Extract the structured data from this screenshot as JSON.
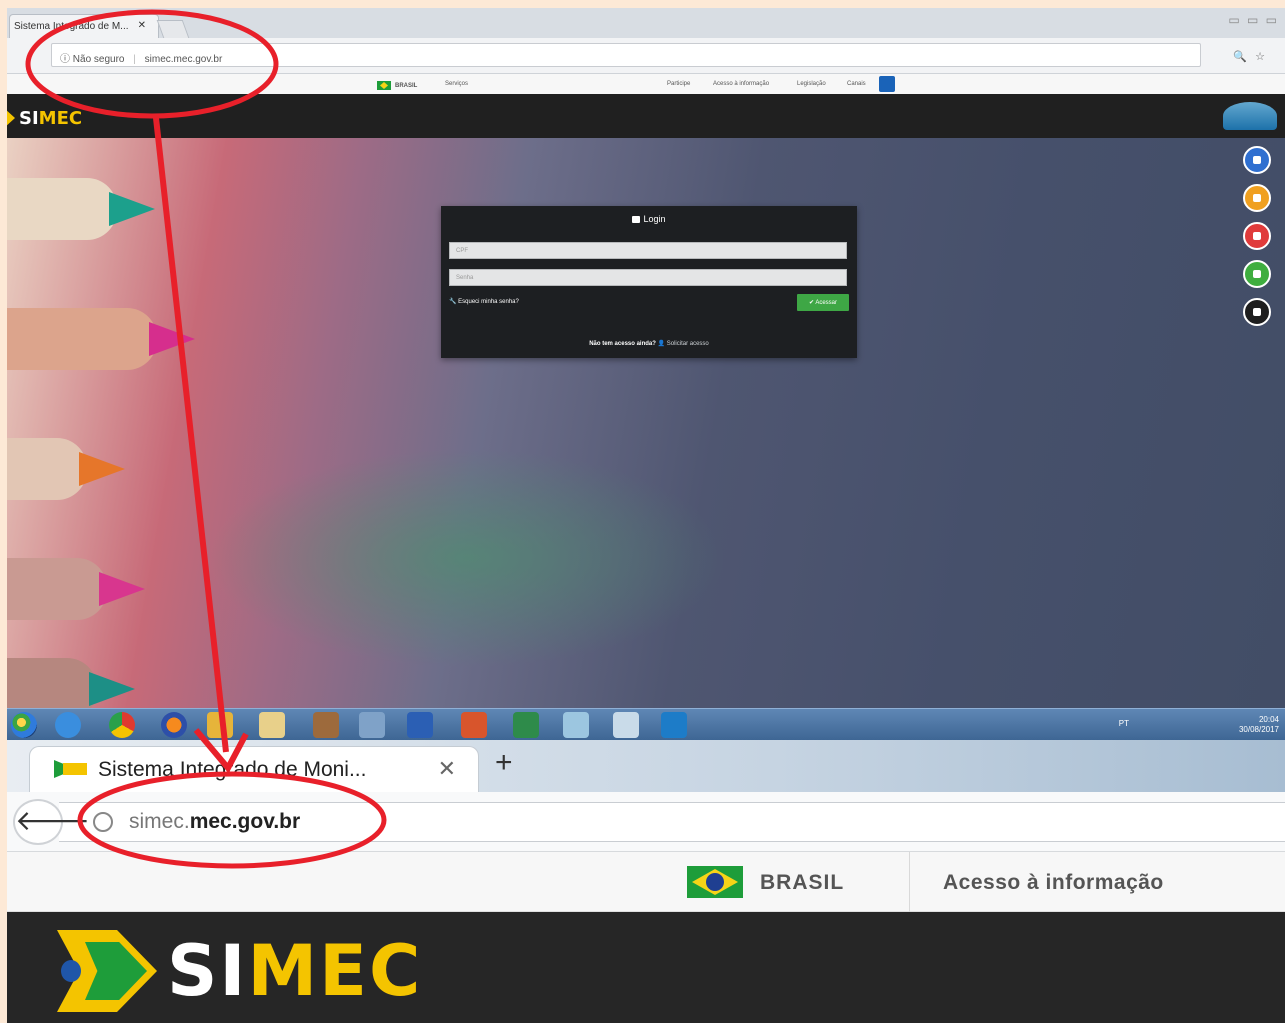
{
  "top": {
    "tab_title": "Sistema Integrado de M...",
    "url_security": "Não seguro",
    "url": "simec.mec.gov.br",
    "gov_bar": {
      "brasil": "BRASIL",
      "servicos": "Serviços",
      "participe": "Participe",
      "acesso": "Acesso à informação",
      "legislacao": "Legislação",
      "canais": "Canais"
    },
    "logo": {
      "white": "SI",
      "yellow": "MEC"
    },
    "login": {
      "title": "Login",
      "cpf_placeholder": "CPF",
      "senha_placeholder": "Senha",
      "forgot": "Esqueci minha senha?",
      "enter": "✔ Acessar",
      "no_access": "Não tem acesso ainda?",
      "request": "Solicitar acesso"
    },
    "taskbar": {
      "lang": "PT",
      "time": "20:04",
      "date": "30/08/2017"
    },
    "side_icon_colors": [
      "#2f6fd0",
      "#f0a020",
      "#e03b3b",
      "#3fae3f",
      "#1e1e1e"
    ]
  },
  "bottom": {
    "tab_title": "Sistema Integrado de Moni...",
    "tab_close": "✕",
    "new_tab": "+",
    "back": "🡐",
    "url_prefix": "simec.",
    "url_domain": "mec.gov.br",
    "brasil": "BRASIL",
    "acesso": "Acesso à informação",
    "logo": {
      "white": "SI",
      "yellow": "MEC"
    }
  },
  "annotation_color": "#e8202a"
}
